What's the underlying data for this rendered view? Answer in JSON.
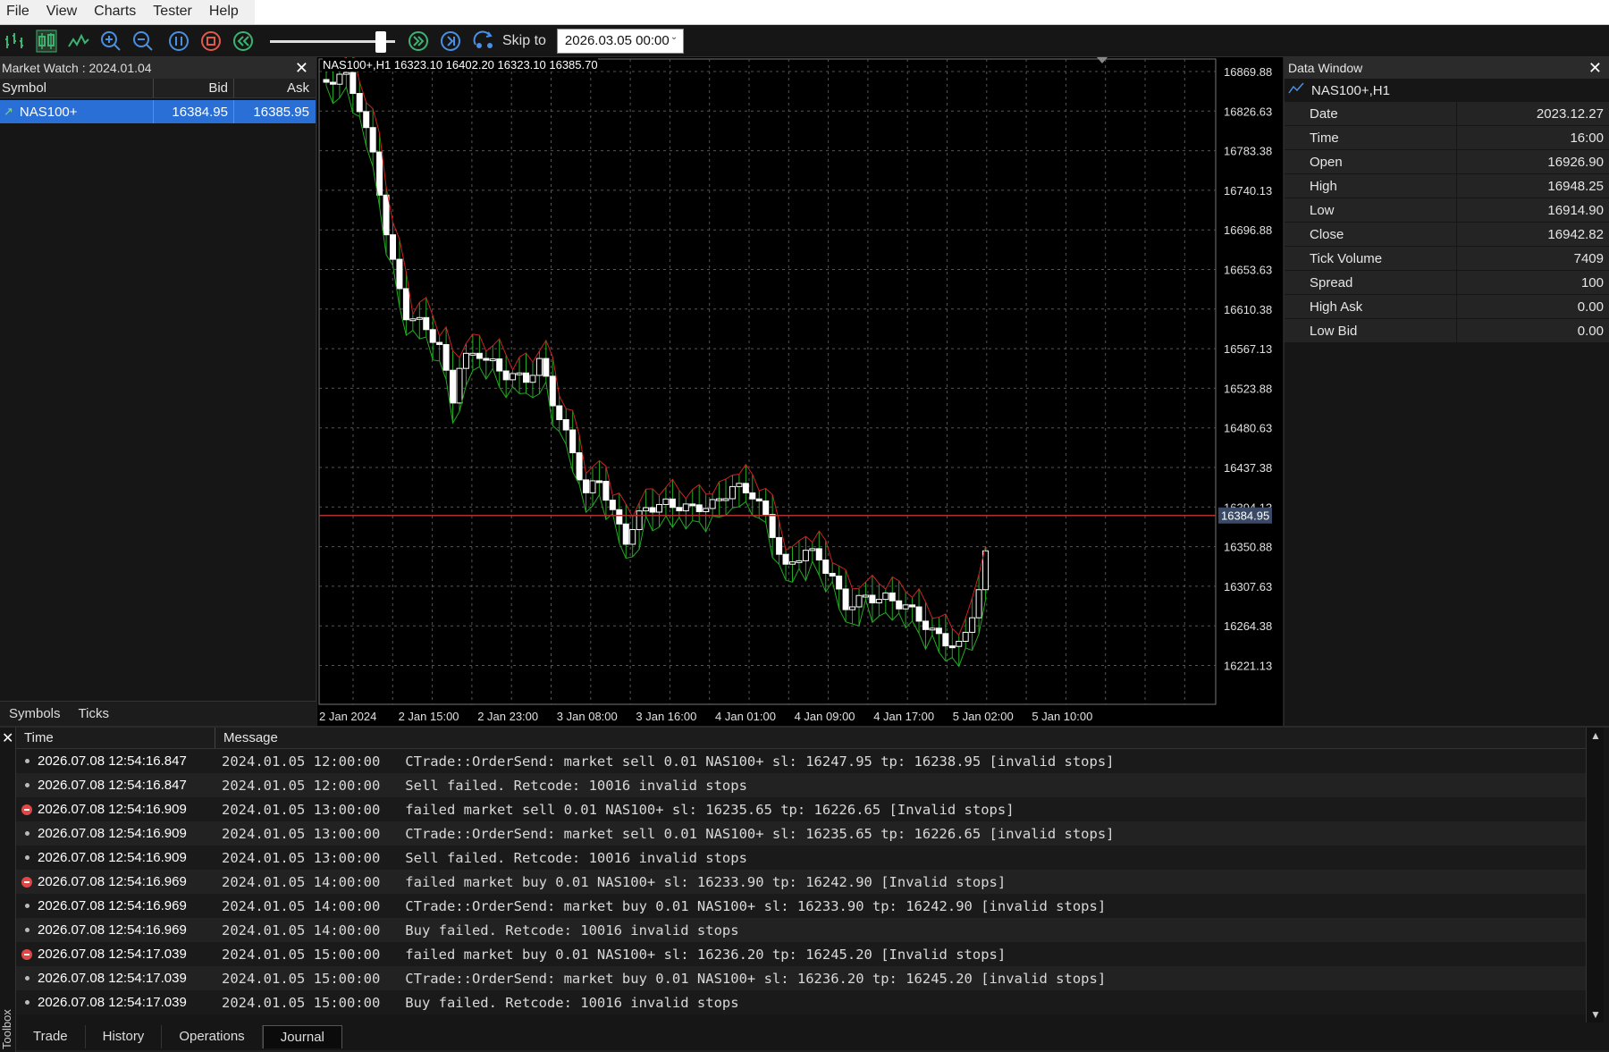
{
  "menu": {
    "items": [
      "File",
      "View",
      "Charts",
      "Tester",
      "Help"
    ]
  },
  "toolbar": {
    "icons": [
      "bar-chart-icon",
      "candle-chart-icon",
      "line-chart-icon",
      "zoom-in-icon",
      "zoom-out-icon",
      "pause-icon",
      "stop-icon",
      "rewind-icon",
      "fast-forward-icon",
      "next-icon",
      "skip-to-icon"
    ],
    "speed_level": 0.88,
    "skip_label": "Skip to",
    "skip_value": "2026.03.05 00:00"
  },
  "market_watch": {
    "title": "Market Watch : 2024.01.04",
    "columns": [
      "Symbol",
      "Bid",
      "Ask"
    ],
    "rows": [
      {
        "symbol": "NAS100+",
        "bid": "16384.95",
        "ask": "16385.95"
      }
    ],
    "tabs": [
      "Symbols",
      "Ticks"
    ]
  },
  "chart": {
    "info": "NAS100+,H1  16323.10 16402.20 16323.10 16385.70",
    "price_labels": [
      "16869.88",
      "16826.63",
      "16783.38",
      "16740.13",
      "16696.88",
      "16653.63",
      "16610.38",
      "16567.13",
      "16523.88",
      "16480.63",
      "16437.38",
      "16394.13",
      "16350.88",
      "16307.63",
      "16264.38",
      "16221.13"
    ],
    "current_price": "16384.95",
    "time_labels": [
      "2 Jan 2024",
      "2 Jan 15:00",
      "2 Jan 23:00",
      "3 Jan 08:00",
      "3 Jan 16:00",
      "4 Jan 01:00",
      "4 Jan 09:00",
      "4 Jan 17:00",
      "5 Jan 02:00",
      "5 Jan 10:00"
    ],
    "colors": {
      "bull": "#ffffff",
      "bear": "#000000",
      "wick": "#22aa22",
      "line": "#cc2222",
      "grid": "#555555",
      "current": "#b03030"
    }
  },
  "data_window": {
    "title": "Data Window",
    "symbol": "NAS100+,H1",
    "rows": [
      {
        "k": "Date",
        "v": "2023.12.27"
      },
      {
        "k": "Time",
        "v": "16:00"
      },
      {
        "k": "Open",
        "v": "16926.90"
      },
      {
        "k": "High",
        "v": "16948.25"
      },
      {
        "k": "Low",
        "v": "16914.90"
      },
      {
        "k": "Close",
        "v": "16942.82"
      },
      {
        "k": "Tick Volume",
        "v": "7409"
      },
      {
        "k": "Spread",
        "v": "100"
      },
      {
        "k": "High Ask",
        "v": "0.00"
      },
      {
        "k": "Low Bid",
        "v": "0.00"
      }
    ]
  },
  "toolbox": {
    "side_label": "Toolbox",
    "columns": [
      "Time",
      "Message"
    ],
    "rows": [
      {
        "type": "info",
        "time": "2026.07.08 12:54:16.847",
        "msg": "2024.01.05 12:00:00   CTrade::OrderSend: market sell 0.01 NAS100+ sl: 16247.95 tp: 16238.95 [invalid stops]"
      },
      {
        "type": "info",
        "time": "2026.07.08 12:54:16.847",
        "msg": "2024.01.05 12:00:00   Sell failed. Retcode: 10016 invalid stops"
      },
      {
        "type": "error",
        "time": "2026.07.08 12:54:16.909",
        "msg": "2024.01.05 13:00:00   failed market sell 0.01 NAS100+ sl: 16235.65 tp: 16226.65 [Invalid stops]"
      },
      {
        "type": "info",
        "time": "2026.07.08 12:54:16.909",
        "msg": "2024.01.05 13:00:00   CTrade::OrderSend: market sell 0.01 NAS100+ sl: 16235.65 tp: 16226.65 [invalid stops]"
      },
      {
        "type": "info",
        "time": "2026.07.08 12:54:16.909",
        "msg": "2024.01.05 13:00:00   Sell failed. Retcode: 10016 invalid stops"
      },
      {
        "type": "error",
        "time": "2026.07.08 12:54:16.969",
        "msg": "2024.01.05 14:00:00   failed market buy 0.01 NAS100+ sl: 16233.90 tp: 16242.90 [Invalid stops]"
      },
      {
        "type": "info",
        "time": "2026.07.08 12:54:16.969",
        "msg": "2024.01.05 14:00:00   CTrade::OrderSend: market buy 0.01 NAS100+ sl: 16233.90 tp: 16242.90 [invalid stops]"
      },
      {
        "type": "info",
        "time": "2026.07.08 12:54:16.969",
        "msg": "2024.01.05 14:00:00   Buy failed. Retcode: 10016 invalid stops"
      },
      {
        "type": "error",
        "time": "2026.07.08 12:54:17.039",
        "msg": "2024.01.05 15:00:00   failed market buy 0.01 NAS100+ sl: 16236.20 tp: 16245.20 [Invalid stops]"
      },
      {
        "type": "info",
        "time": "2026.07.08 12:54:17.039",
        "msg": "2024.01.05 15:00:00   CTrade::OrderSend: market buy 0.01 NAS100+ sl: 16236.20 tp: 16245.20 [invalid stops]"
      },
      {
        "type": "info",
        "time": "2026.07.08 12:54:17.039",
        "msg": "2024.01.05 15:00:00   Buy failed. Retcode: 10016 invalid stops"
      }
    ],
    "tabs": [
      "Trade",
      "History",
      "Operations",
      "Journal"
    ],
    "active_tab": "Journal"
  }
}
